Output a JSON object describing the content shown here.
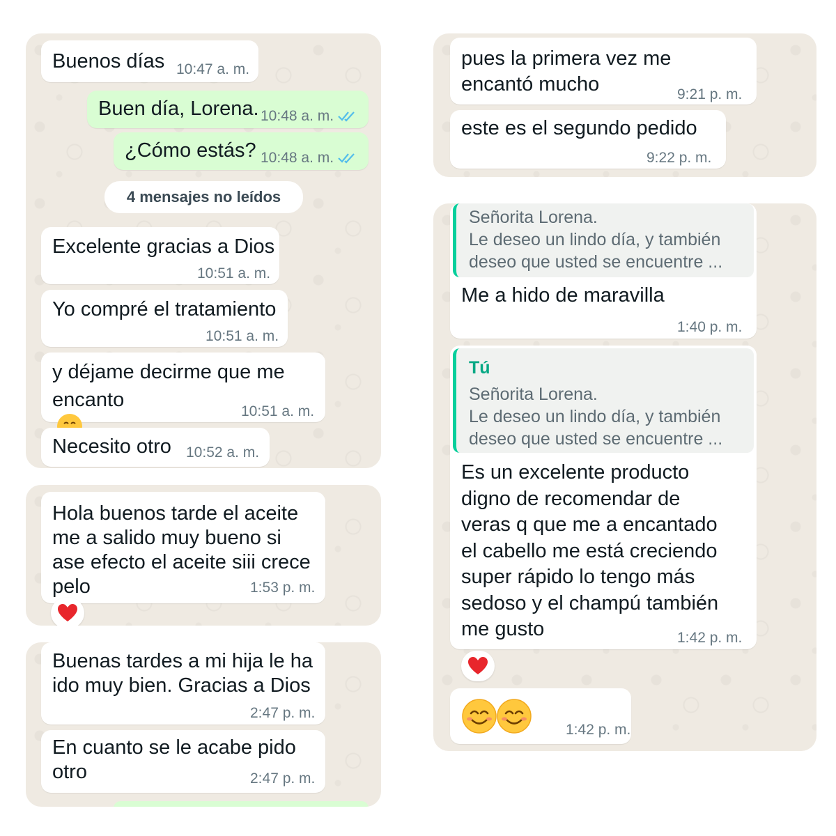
{
  "panel1": {
    "incoming_1": {
      "text": "Buenos días",
      "time": "10:47 a. m."
    },
    "outgoing_1": {
      "text": "Buen día, Lorena.",
      "time": "10:48 a. m."
    },
    "outgoing_2": {
      "text": "¿Cómo estás?",
      "time": "10:48 a. m."
    },
    "unread_label": "4 mensajes no leídos",
    "incoming_2": {
      "text": "Excelente gracias a Dios",
      "time": "10:51 a. m."
    },
    "incoming_3": {
      "text": "Yo compré el tratamiento",
      "time": "10:51 a. m."
    },
    "incoming_4": {
      "text_line1": "y déjame decirme que me",
      "text_line2": "encanto",
      "time": "10:51 a. m."
    },
    "incoming_5": {
      "text": "Necesito otro",
      "time": "10:52 a. m."
    }
  },
  "panel2": {
    "incoming_1": {
      "text": "Hola buenos tarde el aceite\nme a salido muy bueno si\nase efecto el aceite siii crece\npelo",
      "time": "1:53 p. m."
    }
  },
  "panel3": {
    "incoming_1": {
      "text": "Buenas tardes a mi hija le ha\nido muy bien. Gracias a Dios",
      "time": "2:47 p. m."
    },
    "incoming_2": {
      "text": "En cuanto se le acabe pido\notro",
      "time": "2:47 p. m."
    }
  },
  "panel4": {
    "incoming_1": {
      "text": "pues la primera vez me\nencantó mucho",
      "time": "9:21 p. m."
    },
    "incoming_2": {
      "text": "este es el segundo pedido",
      "time": "9:22 p. m."
    }
  },
  "panel5": {
    "incoming_1": {
      "quote_text": "Señorita Lorena.\nLe deseo un lindo día, y también\ndeseo que usted se encuentre ...",
      "text": "Me a hido de maravilla",
      "time": "1:40 p. m."
    },
    "incoming_2": {
      "quote_sender": "Tú",
      "quote_text": "Señorita Lorena.\nLe deseo un lindo día, y también\ndeseo que usted se encuentre ...",
      "text": "Es un excelente producto\ndigno de recomendar de\nveras q que me a encantado\nel cabello me está creciendo\nsuper rápido lo tengo más\nsedoso y el champú también\nme gusto",
      "time": "1:42 p. m."
    },
    "incoming_3": {
      "emoji": "smiling-face-with-smiling-eyes x2",
      "time": "1:42 p. m."
    }
  },
  "colors": {
    "chat_background": "#efeae2",
    "incoming_bubble": "#ffffff",
    "outgoing_bubble": "#d9fdd3",
    "read_ticks": "#53bdeb",
    "quote_bar": "#06cf9c",
    "timestamp": "#667781",
    "heart": "#e8262c"
  },
  "icons": [
    "double-check-icon",
    "heart-reaction-icon",
    "hugging-face-emoji",
    "smiling-face-emoji"
  ]
}
